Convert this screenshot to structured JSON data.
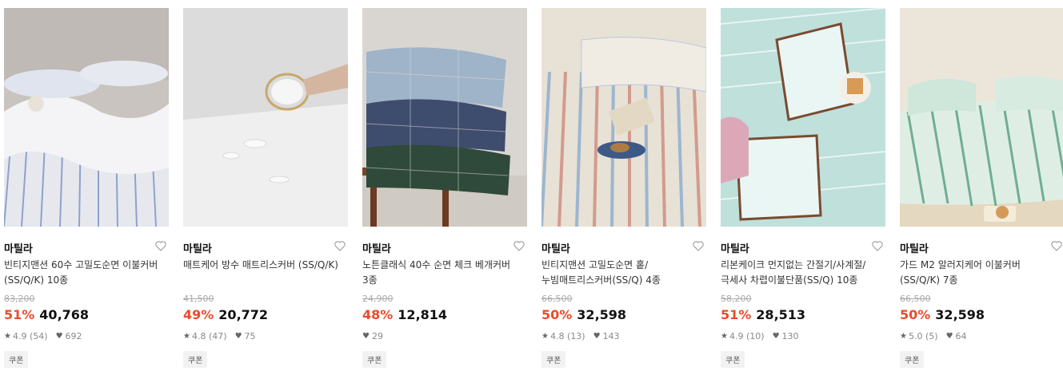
{
  "products": [
    {
      "brand": "마틸라",
      "title": "빈티지맨션 60수 고밀도순면 이불커버(SS/Q/K) 10종",
      "original_price": "83,200",
      "discount": "51%",
      "price": "40,768",
      "rating": "4.9",
      "reviews": "(54)",
      "likes": "692",
      "coupon": "쿠폰",
      "image": "striped-bedding-photo"
    },
    {
      "brand": "마틸라",
      "title": "매트케어 방수 매트리스커버 (SS/Q/K)",
      "original_price": "41,500",
      "discount": "49%",
      "price": "20,772",
      "rating": "4.8",
      "reviews": "(47)",
      "likes": "75",
      "coupon": "쿠폰",
      "image": "waterproof-spill-photo"
    },
    {
      "brand": "마틸라",
      "title": "노튼클래식 40수 순면 체크 베개커버 3종",
      "original_price": "24,900",
      "discount": "48%",
      "price": "12,814",
      "rating": "",
      "reviews": "",
      "likes": "29",
      "coupon": "쿠폰",
      "image": "check-pillows-photo"
    },
    {
      "brand": "마틸라",
      "title": "빈티지맨션 고밀도순면 홑/누빔매트리스커버(SS/Q) 4종",
      "original_price": "66,500",
      "discount": "50%",
      "price": "32,598",
      "rating": "4.8",
      "reviews": "(13)",
      "likes": "143",
      "coupon": "쿠폰",
      "image": "stripe-mattress-photo"
    },
    {
      "brand": "마틸라",
      "title": "리본케이크 먼지없는 간절기/사계절/극세사 차렵이불단품(SS/Q) 10종",
      "original_price": "58,200",
      "discount": "51%",
      "price": "28,513",
      "rating": "4.9",
      "reviews": "(10)",
      "likes": "130",
      "coupon": "쿠폰",
      "image": "ribbon-quilt-photo"
    },
    {
      "brand": "마틸라",
      "title": "가드 M2 알러지케어 이불커버 (SS/Q/K) 7종",
      "original_price": "66,500",
      "discount": "50%",
      "price": "32,598",
      "rating": "5.0",
      "reviews": "(5)",
      "likes": "64",
      "coupon": "쿠폰",
      "image": "mint-stripe-bedding-photo"
    }
  ],
  "colors": {
    "discount": "#ec4a2a",
    "text": "#222222",
    "muted": "#888888",
    "coupon_bg": "#f2f2f2"
  },
  "icons": {
    "wishlist": "heart-outline-icon",
    "rating": "star-icon",
    "likes": "heart-filled-icon"
  }
}
